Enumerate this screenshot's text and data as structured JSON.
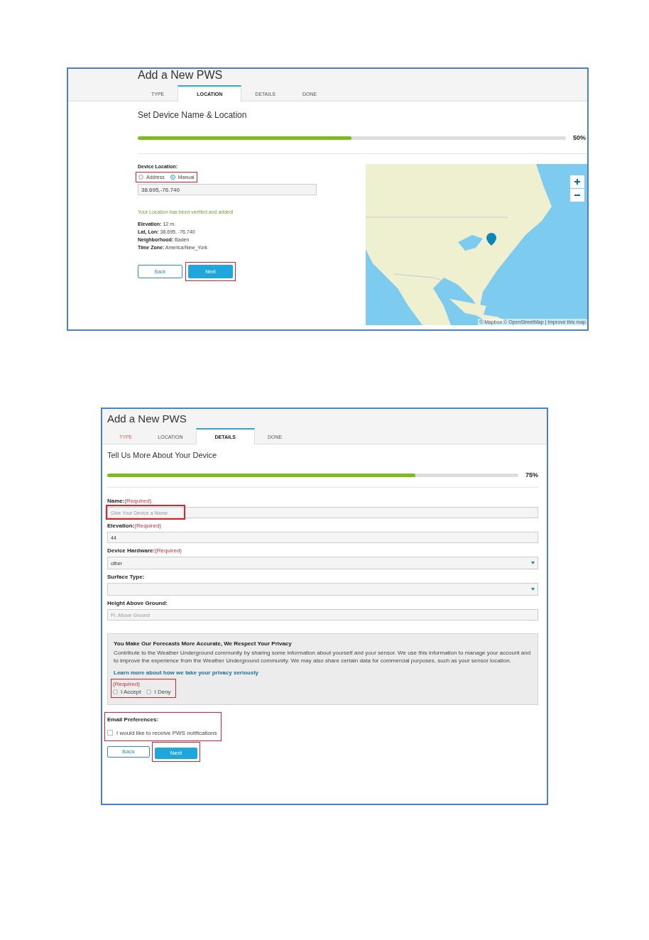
{
  "location_screen": {
    "title": "Add a New PWS",
    "tabs": [
      {
        "label": "TYPE",
        "selected": false,
        "visited": false
      },
      {
        "label": "LOCATION",
        "selected": true,
        "visited": false
      },
      {
        "label": "DETAILS",
        "selected": false,
        "visited": false
      },
      {
        "label": "DONE",
        "selected": false,
        "visited": false
      }
    ],
    "heading": "Set Device Name & Location",
    "progress": {
      "level": 0.5,
      "reading": "50%"
    },
    "location_label": "Device Location:",
    "location_modes": {
      "highlighted": true,
      "options": [
        {
          "label": "Address",
          "selected": false
        },
        {
          "label": "Manual",
          "selected": true
        }
      ]
    },
    "coordinates": "38.695,-76.740",
    "verified_message": "Your Location has been verified and added!",
    "details": [
      {
        "label": "Elevation:",
        "value": "12 m."
      },
      {
        "label": "Lat, Lon:",
        "value": "38.695, -76.740"
      },
      {
        "label": "Neighborhood:",
        "value": "Baden"
      },
      {
        "label": "Time Zone:",
        "value": "America/New_York"
      }
    ],
    "buttons": [
      {
        "label": "Back",
        "kind": "secondary",
        "highlighted": false
      },
      {
        "label": "Next",
        "kind": "primary",
        "highlighted": true
      }
    ],
    "map": {
      "attribution": "© Mapbox © OpenStreetMap | Improve this map"
    }
  },
  "details_screen": {
    "title": "Add a New PWS",
    "tabs": [
      {
        "label": "TYPE",
        "selected": false,
        "visited": true
      },
      {
        "label": "LOCATION",
        "selected": false,
        "visited": false
      },
      {
        "label": "DETAILS",
        "selected": true,
        "visited": false
      },
      {
        "label": "DONE",
        "selected": false,
        "visited": false
      }
    ],
    "heading": "Tell Us More About Your Device",
    "progress": {
      "level": 0.75,
      "reading": "75%"
    },
    "fields": [
      {
        "kind": "text",
        "label": "Name:",
        "required": "(Required)",
        "placeholder": "Give Your Device a Name",
        "highlighted": true
      },
      {
        "kind": "text",
        "label": "Elevation:",
        "required": "(Required)",
        "value": "44",
        "highlighted": false
      },
      {
        "kind": "select",
        "label": "Device Hardware:",
        "required": "(Required)",
        "value": "other",
        "highlighted": false
      },
      {
        "kind": "select",
        "label": "Surface Type:",
        "highlighted": false
      },
      {
        "kind": "text",
        "label": "Height Above Ground:",
        "placeholder": "Ft. Above Ground",
        "highlighted": false
      }
    ],
    "privacy": {
      "title": "You Make Our Forecasts More Accurate, We Respect Your Privacy",
      "body": "Contribute to the Weather Underground community by sharing some information about yourself and your sensor. We use this information to manage your account and to improve the experience from the Weather Underground community. We may also share certain data for commercial purposes, such as your sensor location.",
      "link": "Learn more about how we take your privacy seriously",
      "required": "(Required)",
      "highlighted": true,
      "options": [
        {
          "label": "I Accept",
          "selected": false
        },
        {
          "label": "I Deny",
          "selected": false
        }
      ]
    },
    "email": {
      "label": "Email Preferences:",
      "option": "I would like to receive PWS notifications",
      "checked": false,
      "highlighted": true
    },
    "buttons": [
      {
        "label": "Back",
        "kind": "secondary",
        "highlighted": false
      },
      {
        "label": "Next",
        "kind": "primary",
        "highlighted": true
      }
    ]
  }
}
